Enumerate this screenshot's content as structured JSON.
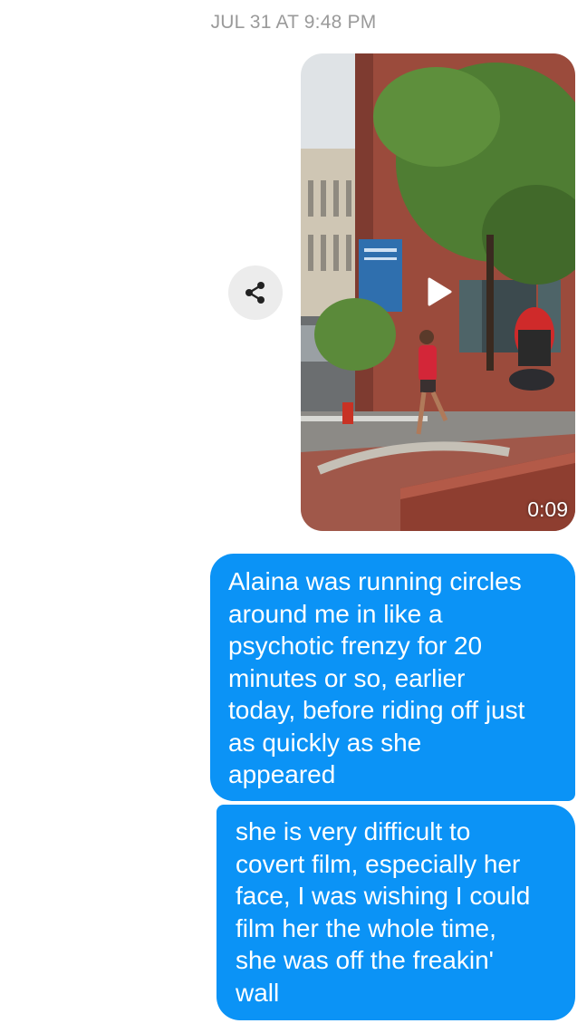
{
  "thread": {
    "timestamp": "JUL 31 AT 9:48 PM"
  },
  "video_message": {
    "duration": "0:09",
    "share_icon": "share-icon",
    "play_icon": "play-icon"
  },
  "messages": [
    {
      "lines": [
        "Alaina was running circles",
        "around me in like a",
        "psychotic frenzy for 20",
        "minutes or so, earlier",
        "today, before riding off just",
        "as quickly as she",
        "appeared"
      ]
    },
    {
      "lines": [
        "she is very difficult to",
        "covert film, especially her",
        "face, I was wishing I could",
        "film her the whole time,",
        "she was off the freakin'",
        "wall"
      ]
    }
  ],
  "colors": {
    "sent_bubble": "#0b93f6",
    "timestamp_text": "#9a9a9a",
    "share_button_bg": "#ececec"
  }
}
